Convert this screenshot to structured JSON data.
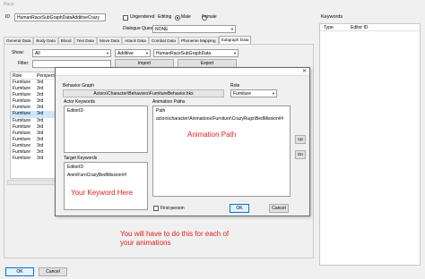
{
  "window": {
    "title": "Race"
  },
  "top": {
    "id_label": "ID",
    "id_value": "HumanRaceSubGraphDataAdditiveCrazy",
    "ungendered_label": "Ungendered",
    "editing_label": "Editing",
    "male_label": "Male",
    "female_label": "Female",
    "dialogue_quest_label": "Dialogue Quest",
    "dialogue_quest_value": "NONE"
  },
  "tabs": [
    "General Data",
    "Body Data",
    "Blood",
    "Text Data",
    "Move Data",
    "Attack Data",
    "Combat Data",
    "Phoneme Mapping",
    "Subgraph Data"
  ],
  "active_tab": "Subgraph Data",
  "subgraph": {
    "show_label": "Show:",
    "show_value": "All",
    "additive_value": "Additive",
    "race_value": "HumanRaceSubGraphData",
    "filter_label": "Filter:",
    "import_label": "Import",
    "export_label": "Export",
    "columns": [
      "Role",
      "Perspect..."
    ],
    "rows": [
      [
        "Furniture",
        "3rd"
      ],
      [
        "Furniture",
        "3rd"
      ],
      [
        "Furniture",
        "3rd"
      ],
      [
        "Furniture",
        "3rd"
      ],
      [
        "Furniture",
        "3rd"
      ],
      [
        "Furniture",
        "3rd"
      ],
      [
        "Furniture",
        "3rd"
      ],
      [
        "Furniture",
        "3rd"
      ],
      [
        "Furniture",
        "3rd"
      ],
      [
        "Furniture",
        "3rd"
      ],
      [
        "Furniture",
        "3rd"
      ],
      [
        "Furniture",
        "3rd"
      ],
      [
        "Furniture",
        "3rd"
      ]
    ],
    "selected_row": 5
  },
  "keywords_panel": {
    "title": "Keywords",
    "columns": [
      "Type",
      "Editor ID"
    ]
  },
  "dialog": {
    "behavior_graph_label": "Behavior Graph",
    "behavior_graph_value": "Actors\\Character\\Behaviors\\FurnitureBehavior.hkx",
    "role_label": "Role",
    "role_value": "Furniture",
    "actor_keywords_label": "Actor Keywords",
    "actor_keywords_column": "EditorID",
    "animation_paths_label": "Animation Paths",
    "path_column": "Path",
    "path_value": "actors\\character\\Animations\\Furniture\\CrazyRugs\\BedMission##",
    "annotation_animation_path": "Animation Path",
    "up_label": "Up",
    "dn_label": "Dn",
    "target_keywords_label": "Target Keywords",
    "target_keywords_column": "EditorID",
    "target_keyword_value": "AnimFurnCrazyBedMission##",
    "annotation_keyword": "Your Keyword Here",
    "first_person_label": "First-person",
    "ok_label": "OK",
    "cancel_label": "Cancel"
  },
  "annotation_footer": [
    "You will have to do this for each of",
    "your animations"
  ],
  "bottom": {
    "ok_label": "OK",
    "cancel_label": "Cancel"
  },
  "colors": {
    "annotation": "#e02020",
    "selection": "#cde8ff",
    "focus_border": "#0078d7"
  }
}
